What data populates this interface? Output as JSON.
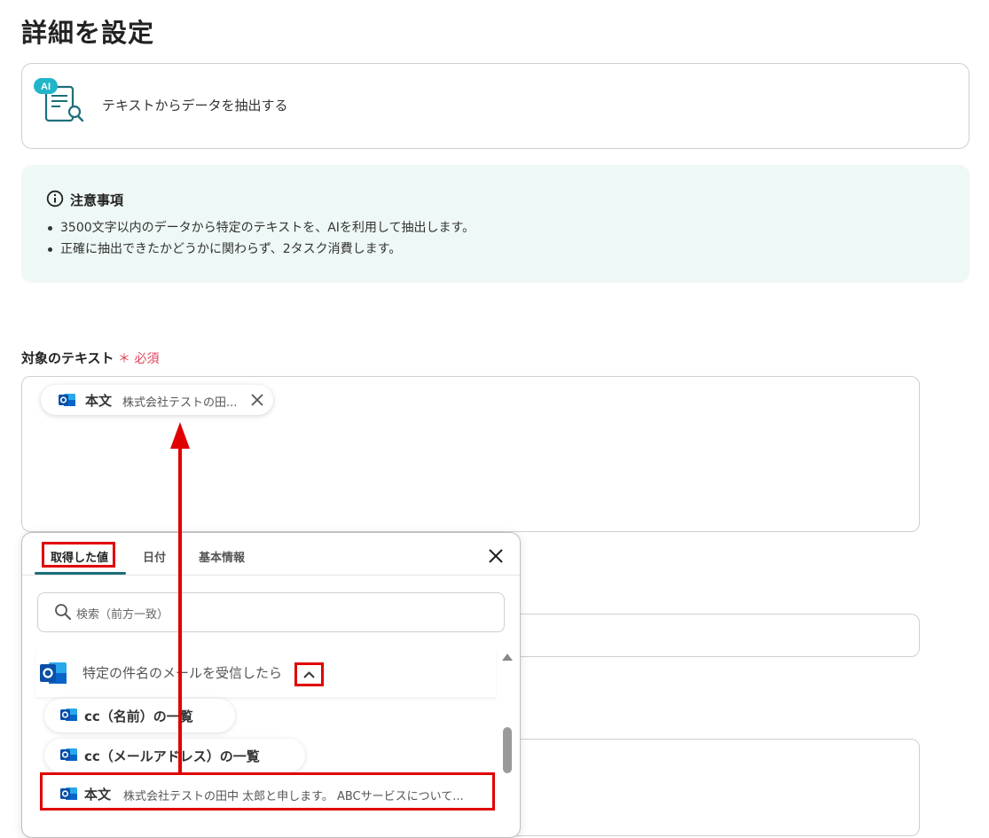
{
  "page": {
    "title": "詳細を設定"
  },
  "operation": {
    "badge": "AI",
    "label": "テキストからデータを抽出する"
  },
  "notice": {
    "title": "注意事項",
    "items": [
      "3500文字以内のデータから特定のテキストを、AIを利用して抽出します。",
      "正確に抽出できたかどうかに関わらず、2タスク消費します。"
    ]
  },
  "field": {
    "label": "対象のテキスト",
    "required": "＊ 必須",
    "chip": {
      "title": "本文",
      "value": "株式会社テストの田..."
    }
  },
  "picker": {
    "tabs": [
      "取得した値",
      "日付",
      "基本情報"
    ],
    "search_placeholder": "検索（前方一致）",
    "group_label": "特定の件名のメールを受信したら",
    "items": [
      {
        "title": "cc（名前）の一覧",
        "value": ""
      },
      {
        "title": "cc（メールアドレス）の一覧",
        "value": ""
      },
      {
        "title": "本文",
        "value": "株式会社テストの田中 太郎と申します。 ABCサービスについて..."
      }
    ]
  },
  "colors": {
    "accent": "#1c6f7a",
    "highlight": "#e00000",
    "required": "#e0425a",
    "notice_bg": "#eef8f6",
    "outlook": "#0a64c8"
  }
}
